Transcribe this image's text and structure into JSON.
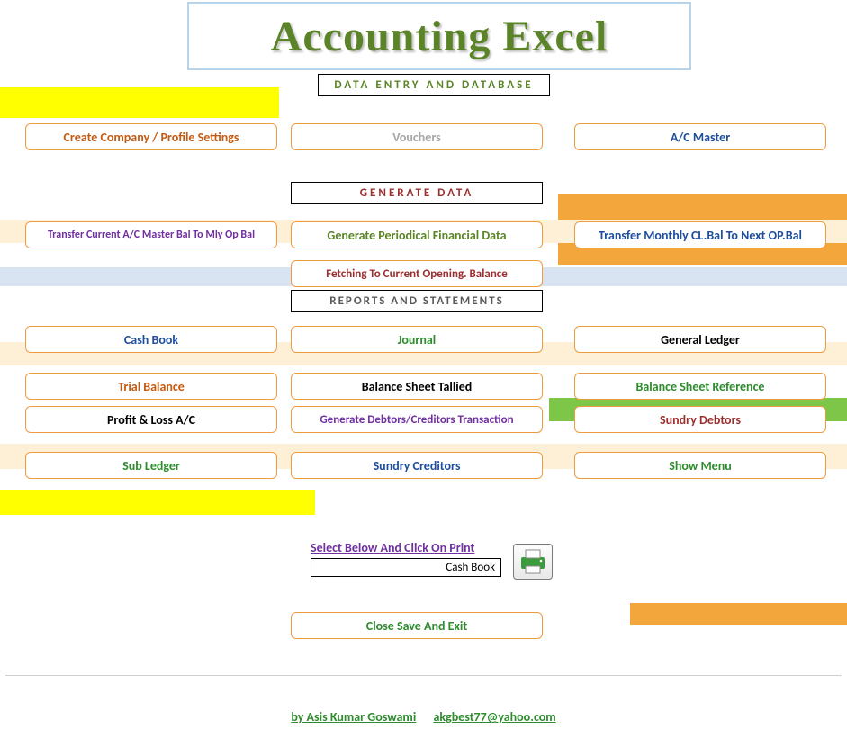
{
  "title": "Accounting Excel",
  "sections": {
    "data_entry": "DATA ENTRY AND DATABASE",
    "generate": "GENERATE  DATA",
    "reports": "REPORTS  AND  STATEMENTS"
  },
  "buttons": {
    "create_company": "Create Company / Profile Settings",
    "vouchers": "Vouchers",
    "ac_master": "A/C   Master",
    "transfer_mly": "Transfer Current  A/C Master  Bal   To Mly Op Bal",
    "gen_periodical": "Generate Periodical Financial Data",
    "transfer_monthly": "Transfer Monthly  CL.Bal To Next OP.Bal",
    "fetch_opening": "Fetching  To Current Opening. Balance",
    "cash_book": "Cash Book",
    "journal": "Journal",
    "general_ledger": "General Ledger",
    "trial_balance": "Trial Balance",
    "balance_tallied": "Balance Sheet Tallied",
    "balance_ref": "Balance Sheet Reference",
    "profit_loss": "Profit & Loss A/C",
    "debtors_creditors": "Generate Debtors/Creditors Transaction",
    "sundry_debtors": "Sundry Debtors",
    "sub_ledger": "Sub Ledger",
    "sundry_creditors": "Sundry Creditors",
    "show_menu": "Show Menu",
    "close_save": "Close Save And Exit"
  },
  "print": {
    "label": "Select Below And Click On Print",
    "selected": "Cash Book"
  },
  "footer": {
    "author": "by Asis Kumar Goswami",
    "email": "akgbest77@yahoo.com"
  },
  "colors": {
    "olive": "#5b8428",
    "orange_text": "#c55a11",
    "green_text": "#2e8b2e",
    "purple": "#7030a0",
    "blue": "#1f4e9c",
    "brown_red": "#9c2e2e",
    "gray_text": "#a6a6a6"
  }
}
